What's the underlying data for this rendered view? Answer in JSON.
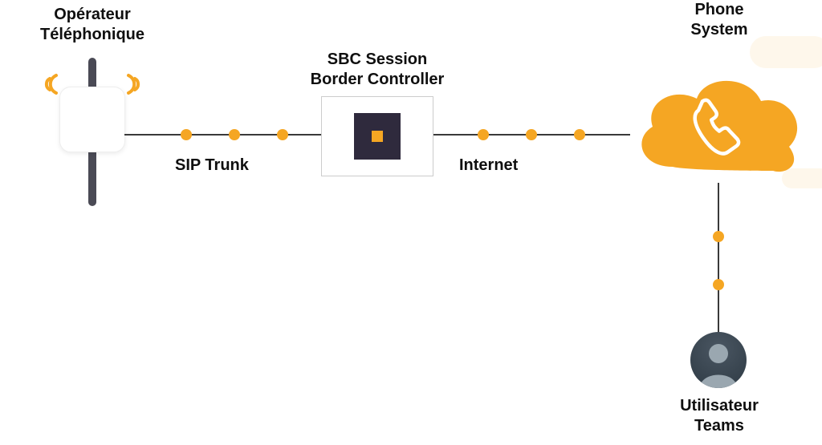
{
  "nodes": {
    "operator": {
      "label": "Opérateur\nTéléphonique"
    },
    "sbc": {
      "label": "SBC Session\nBorder Controller"
    },
    "phone_system": {
      "label": "Phone\nSystem"
    },
    "user": {
      "label": "Utilisateur\nTeams"
    }
  },
  "connections": {
    "sip_trunk": {
      "label": "SIP Trunk"
    },
    "internet": {
      "label": "Internet"
    }
  },
  "colors": {
    "accent": "#f5a623",
    "dark": "#2f2a3d",
    "line": "#3a3a3a"
  }
}
